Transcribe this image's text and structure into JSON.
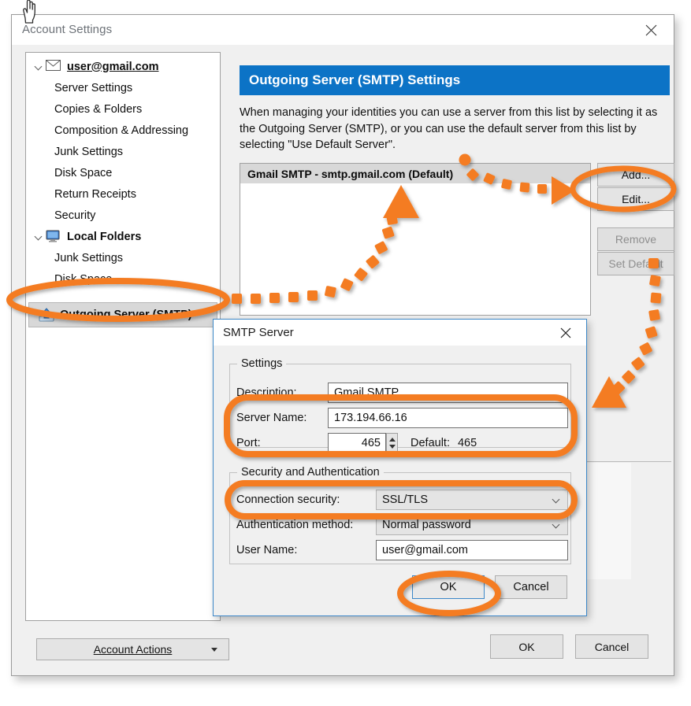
{
  "window": {
    "title": "Account Settings",
    "close_icon": "close-icon"
  },
  "sidebar": {
    "items": [
      {
        "label": "user@gmail.com",
        "type": "account-root",
        "icon": "envelope-icon",
        "expanded": true
      },
      {
        "label": "Server Settings",
        "type": "child"
      },
      {
        "label": "Copies & Folders",
        "type": "child"
      },
      {
        "label": "Composition & Addressing",
        "type": "child"
      },
      {
        "label": "Junk Settings",
        "type": "child"
      },
      {
        "label": "Disk Space",
        "type": "child"
      },
      {
        "label": "Return Receipts",
        "type": "child"
      },
      {
        "label": "Security",
        "type": "child"
      },
      {
        "label": "Local Folders",
        "type": "folder-root",
        "icon": "computer-icon",
        "expanded": true
      },
      {
        "label": "Junk Settings",
        "type": "child"
      },
      {
        "label": "Disk Space",
        "type": "child"
      }
    ],
    "selected_item": {
      "label": "Outgoing Server (SMTP)",
      "icon": "outgoing-server-icon",
      "selected": true
    },
    "account_actions": {
      "label": "Account Actions",
      "accel": "A",
      "caret_icon": "caret-down-icon"
    }
  },
  "main": {
    "header": "Outgoing Server (SMTP) Settings",
    "description": "When managing your identities you can use a server from this list by selecting it as the Outgoing Server (SMTP), or you can use the default server from this list by selecting \"Use Default Server\".",
    "server_list": [
      {
        "label": "Gmail SMTP - smtp.gmail.com (Default)",
        "selected": true
      }
    ],
    "buttons": [
      {
        "label": "Add...",
        "accel": "d",
        "enabled": true
      },
      {
        "label": "Edit...",
        "accel": "E",
        "enabled": true
      },
      {
        "label": "Remove",
        "accel": "m",
        "enabled": false
      },
      {
        "label": "Set Default",
        "accel": "t",
        "enabled": false
      }
    ]
  },
  "footer": {
    "ok": "OK",
    "cancel": "Cancel"
  },
  "dialog": {
    "title": "SMTP Server",
    "close_icon": "close-icon",
    "settings_group": {
      "legend": "Settings",
      "fields": [
        {
          "label": "Description:",
          "value": "Gmail SMTP"
        },
        {
          "label": "Server Name:",
          "value": "173.194.66.16"
        },
        {
          "label": "Port:",
          "value": "465",
          "default_label": "Default:",
          "default_value": "465"
        }
      ]
    },
    "security_group": {
      "legend": "Security and Authentication",
      "fields": [
        {
          "label": "Connection security:",
          "value": "SSL/TLS",
          "kind": "select"
        },
        {
          "label": "Authentication method:",
          "value": "Normal password",
          "kind": "select"
        },
        {
          "label": "User Name:",
          "value": "user@gmail.com",
          "kind": "text"
        }
      ]
    },
    "ok": "OK",
    "cancel": "Cancel"
  },
  "annotations": {
    "highlight_color": "#F47C20",
    "ellipses": [
      "sidebar-outgoing-server-highlight",
      "edit-button-highlight",
      "server-name-port-highlight",
      "connection-security-highlight",
      "dialog-ok-highlight"
    ],
    "arrows": [
      "arrow-sidebar-to-list",
      "arrow-list-to-edit",
      "arrow-buttons-to-dialog"
    ]
  }
}
